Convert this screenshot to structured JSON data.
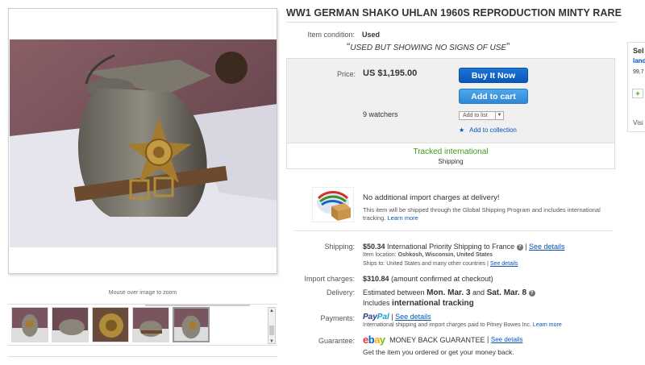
{
  "item": {
    "title": "WW1 GERMAN SHAKO UHLAN 1960S REPRODUCTION MINTY RARE",
    "condition_label": "Item condition:",
    "condition_value": "Used",
    "condition_desc": "USED BUT SHOWING NO SIGNS OF USE"
  },
  "gallery": {
    "zoom_hint": "Mouse over image to zoom",
    "thumbnails": [
      "thumb-1",
      "thumb-2",
      "thumb-3",
      "thumb-4",
      "thumb-5"
    ],
    "selected_index": 4
  },
  "buy_box": {
    "price_label": "Price:",
    "price_value": "US $1,195.00",
    "buy_now": "Buy It Now",
    "add_to_cart": "Add to cart",
    "watchers": "9 watchers",
    "add_to_list": "Add to list",
    "add_to_collection": "Add to collection",
    "tracked": "Tracked international",
    "shipping_sub": "Shipping"
  },
  "import_notice": {
    "title": "No additional import charges at delivery!",
    "text": "This item will be shipped through the Global Shipping Program and includes international tracking.",
    "learn_more": "Learn more"
  },
  "details": {
    "shipping_label": "Shipping:",
    "shipping_cost": "$50.34",
    "shipping_service": "International Priority Shipping to France",
    "see_details": "See details",
    "item_location_label": "Item location:",
    "item_location": "Oshkosh, Wisconsin, United States",
    "ships_to_label": "Ships to:",
    "ships_to": "United States and many other countries",
    "import_label": "Import charges:",
    "import_amount": "$310.84",
    "import_note": "(amount confirmed at checkout)",
    "delivery_label": "Delivery:",
    "delivery_prefix": "Estimated between",
    "delivery_start": "Mon. Mar. 3",
    "delivery_and": "and",
    "delivery_end": "Sat. Mar. 8",
    "delivery_includes": "Includes",
    "delivery_tracking": "international tracking",
    "payments_label": "Payments:",
    "paypal_1": "Pay",
    "paypal_2": "Pal",
    "payments_note": "International shipping and import charges paid to Pitney Bowes Inc.",
    "guarantee_label": "Guarantee:",
    "guarantee_brand": [
      "e",
      "b",
      "a",
      "y"
    ],
    "guarantee_name": "MONEY BACK GUARANTEE",
    "guarantee_text": "Get the item you ordered or get your money back."
  },
  "seller": {
    "heading": "Sel",
    "name": "land",
    "score": "99,7",
    "plus": "+",
    "visit": "Visi"
  },
  "colors": {
    "buy_button": "#0b58b7",
    "cart_button": "#2f88d6",
    "tracked_green": "#3b9c1a",
    "link_blue": "#0654ba"
  }
}
